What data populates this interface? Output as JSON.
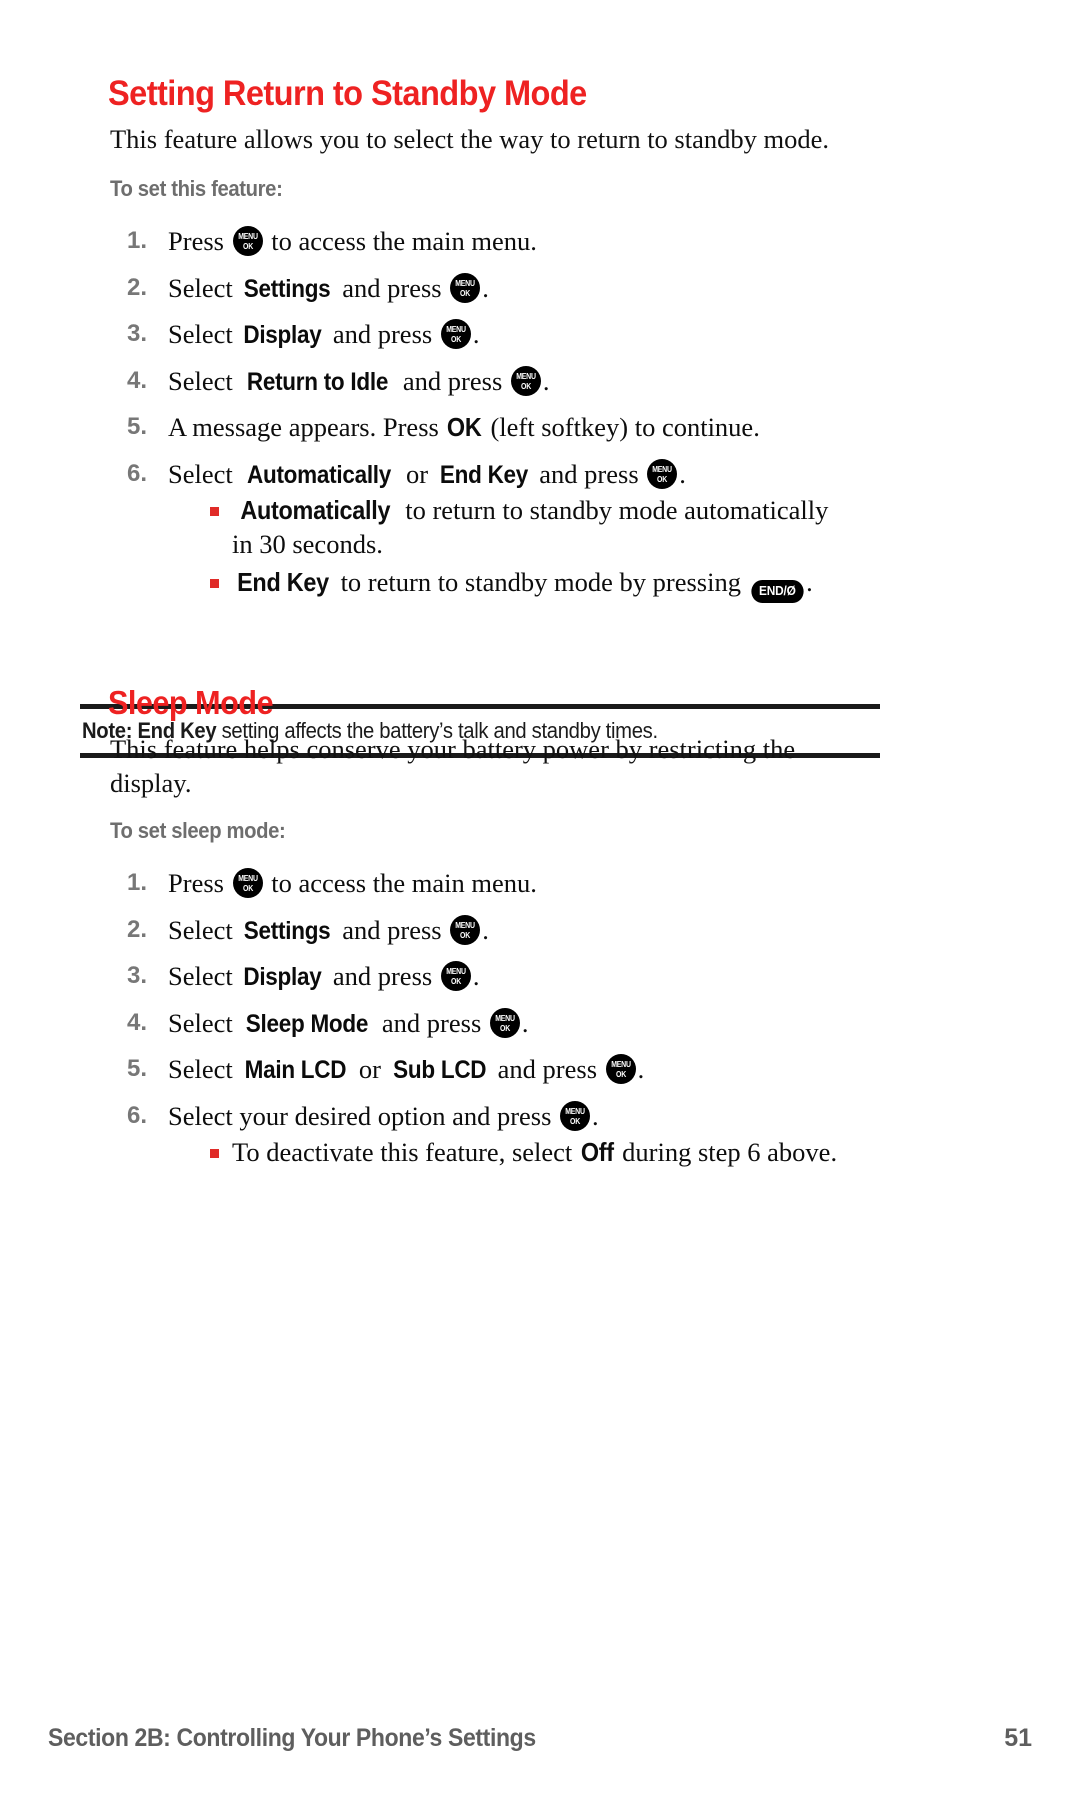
{
  "document": {
    "type": "phone-user-guide-page"
  },
  "sections": [
    {
      "heading": "Setting Return to Standby Mode",
      "intro": "This feature allows you to select the way to return to standby mode.",
      "sub_label": "To set this feature:",
      "steps": [
        {
          "num": "1.",
          "pre": "Press ",
          "icon": "menu-ok-key",
          "post": " to access the main menu."
        },
        {
          "num": "2.",
          "pre": "Select ",
          "term": "Settings",
          "mid": " and press ",
          "icon": "menu-ok-key",
          "post": "."
        },
        {
          "num": "3.",
          "pre": "Select ",
          "term": "Display",
          "mid": " and press ",
          "icon": "menu-ok-key",
          "post": "."
        },
        {
          "num": "4.",
          "pre": "Select ",
          "term": "Return to Idle",
          "mid": " and press ",
          "icon": "menu-ok-key",
          "post": "."
        },
        {
          "num": "5.",
          "pre": "A message appears. Press ",
          "term": "OK",
          "mid": " (left softkey) to continue.",
          "post": ""
        },
        {
          "num": "6.",
          "pre": "Select ",
          "term": "Automatically",
          "mid": " or ",
          "term2": "End Key",
          "mid2": " and press ",
          "icon": "menu-ok-key",
          "post": "."
        }
      ],
      "bullets": [
        {
          "term": "Automatically",
          "text": " to return to standby mode automatically",
          "continuation": "in 30 seconds."
        },
        {
          "term": "End Key",
          "text": " to return to standby mode by pressing ",
          "icon": "end-power-key",
          "after": "."
        }
      ],
      "note": {
        "prefix": "Note:",
        "term": "End Key",
        "text": " setting affects the battery’s talk and standby times."
      }
    },
    {
      "heading": "Sleep Mode",
      "intro": "This feature helps conserve your battery power by restricting the display.",
      "sub_label": "To set sleep mode:",
      "steps": [
        {
          "num": "1.",
          "pre": "Press ",
          "icon": "menu-ok-key",
          "post": " to access the main menu."
        },
        {
          "num": "2.",
          "pre": "Select ",
          "term": "Settings",
          "mid": " and press ",
          "icon": "menu-ok-key",
          "post": "."
        },
        {
          "num": "3.",
          "pre": "Select ",
          "term": "Display",
          "mid": " and press ",
          "icon": "menu-ok-key",
          "post": "."
        },
        {
          "num": "4.",
          "pre": "Select ",
          "term": "Sleep Mode",
          "mid": " and press ",
          "icon": "menu-ok-key",
          "post": "."
        },
        {
          "num": "5.",
          "pre": "Select ",
          "term": "Main LCD",
          "mid": " or ",
          "term2": "Sub LCD",
          "mid2": " and press ",
          "icon": "menu-ok-key",
          "post": "."
        },
        {
          "num": "6.",
          "pre": "Select your desired option and press ",
          "icon": "menu-ok-key",
          "post": "."
        }
      ],
      "bullets": [
        {
          "pre": "To deactivate this feature, select ",
          "term": "Off",
          "text": " during step 6 above."
        }
      ]
    }
  ],
  "icons": {
    "menu_ok": {
      "line1": "MENU",
      "line2": "OK"
    },
    "end_power": {
      "label": "END/Ø"
    }
  },
  "footer": {
    "title": "Section 2B: Controlling Your Phone’s Settings",
    "page": "51"
  },
  "colors": {
    "heading_red": "#ee2222",
    "bullet_red": "#e02b28",
    "sub_label_gray": "#6e6e6e",
    "step_number_gray": "#777777",
    "footer_gray": "#5e5e5e",
    "rule_black": "#1a1a1a"
  }
}
